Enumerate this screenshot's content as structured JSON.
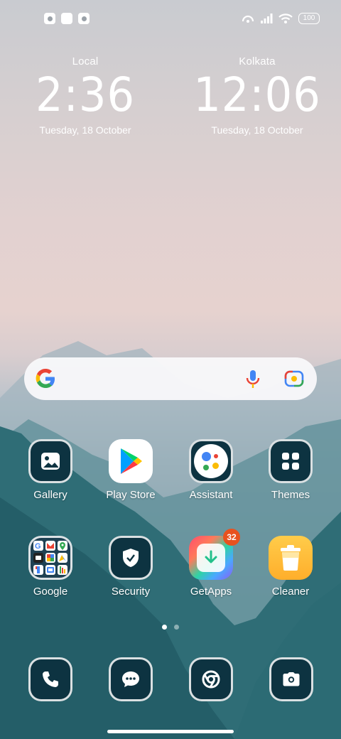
{
  "status_bar": {
    "battery": "100",
    "left_icons": [
      "app-notification-icon",
      "square-notification-icon",
      "app-notification-icon"
    ],
    "right_icons": [
      "hotspot-icon",
      "signal-icon",
      "wifi-icon",
      "battery-icon"
    ]
  },
  "clocks": [
    {
      "label": "Local",
      "time": "2:36",
      "date": "Tuesday, 18 October"
    },
    {
      "label": "Kolkata",
      "time": "12:06",
      "date": "Tuesday, 18 October"
    }
  ],
  "search": {
    "icons": [
      "google-icon",
      "mic-icon",
      "lens-icon"
    ]
  },
  "apps": [
    {
      "name": "Gallery",
      "icon": "gallery-icon"
    },
    {
      "name": "Play Store",
      "icon": "play-store-icon"
    },
    {
      "name": "Assistant",
      "icon": "assistant-icon"
    },
    {
      "name": "Themes",
      "icon": "themes-icon"
    },
    {
      "name": "Google",
      "icon": "google-folder-icon"
    },
    {
      "name": "Security",
      "icon": "security-icon"
    },
    {
      "name": "GetApps",
      "icon": "getapps-icon",
      "badge": "32"
    },
    {
      "name": "Cleaner",
      "icon": "cleaner-icon"
    }
  ],
  "page_indicator": {
    "pages": 2,
    "current": 1
  },
  "dock": [
    {
      "icon": "phone-icon"
    },
    {
      "icon": "messages-icon"
    },
    {
      "icon": "chrome-icon"
    },
    {
      "icon": "camera-icon"
    }
  ],
  "colors": {
    "icon_bg": "#0d3341",
    "badge": "#e8521f",
    "search_bg": "#f8f8fa"
  }
}
